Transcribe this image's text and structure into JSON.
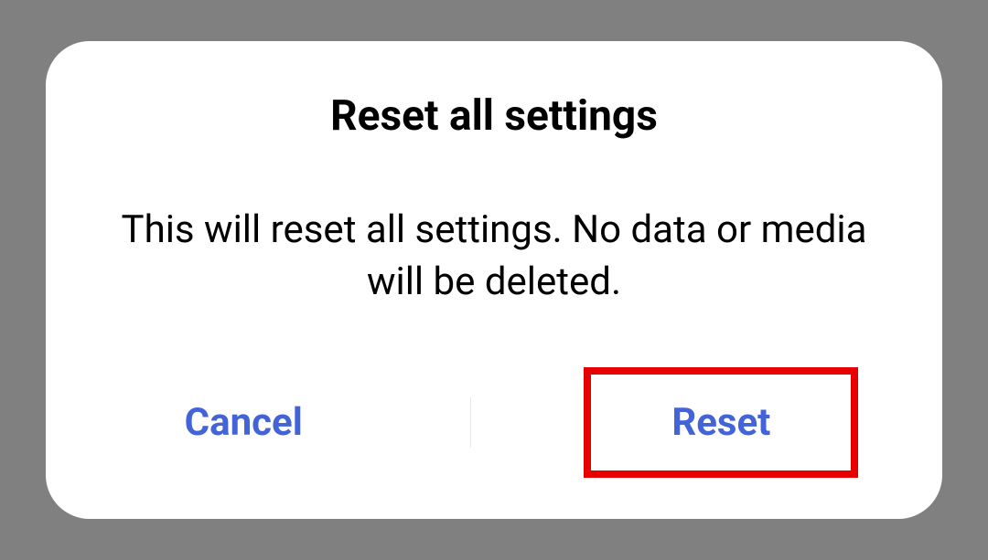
{
  "dialog": {
    "title": "Reset all settings",
    "message": "This will reset all settings. No data or media will be deleted.",
    "cancel_label": "Cancel",
    "confirm_label": "Reset"
  },
  "annotation": {
    "highlighted_button": "reset-button",
    "highlight_color": "#e60000"
  }
}
